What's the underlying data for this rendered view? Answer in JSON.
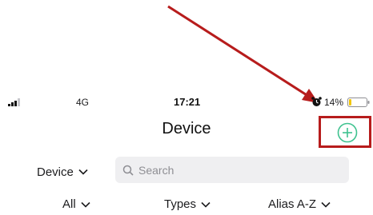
{
  "status_bar": {
    "network": "4G",
    "time": "17:21",
    "battery_percent": "14%",
    "battery_level": 0.14,
    "battery_color": "#f2c500"
  },
  "nav": {
    "title": "Device",
    "add_icon": "add-circle-icon",
    "accent_color": "#3ec28f",
    "highlight_color": "#b71c1c"
  },
  "filters": {
    "device_dropdown_label": "Device",
    "search_placeholder": "Search",
    "all_label": "All",
    "types_label": "Types",
    "sort_label": "Alias A-Z"
  }
}
